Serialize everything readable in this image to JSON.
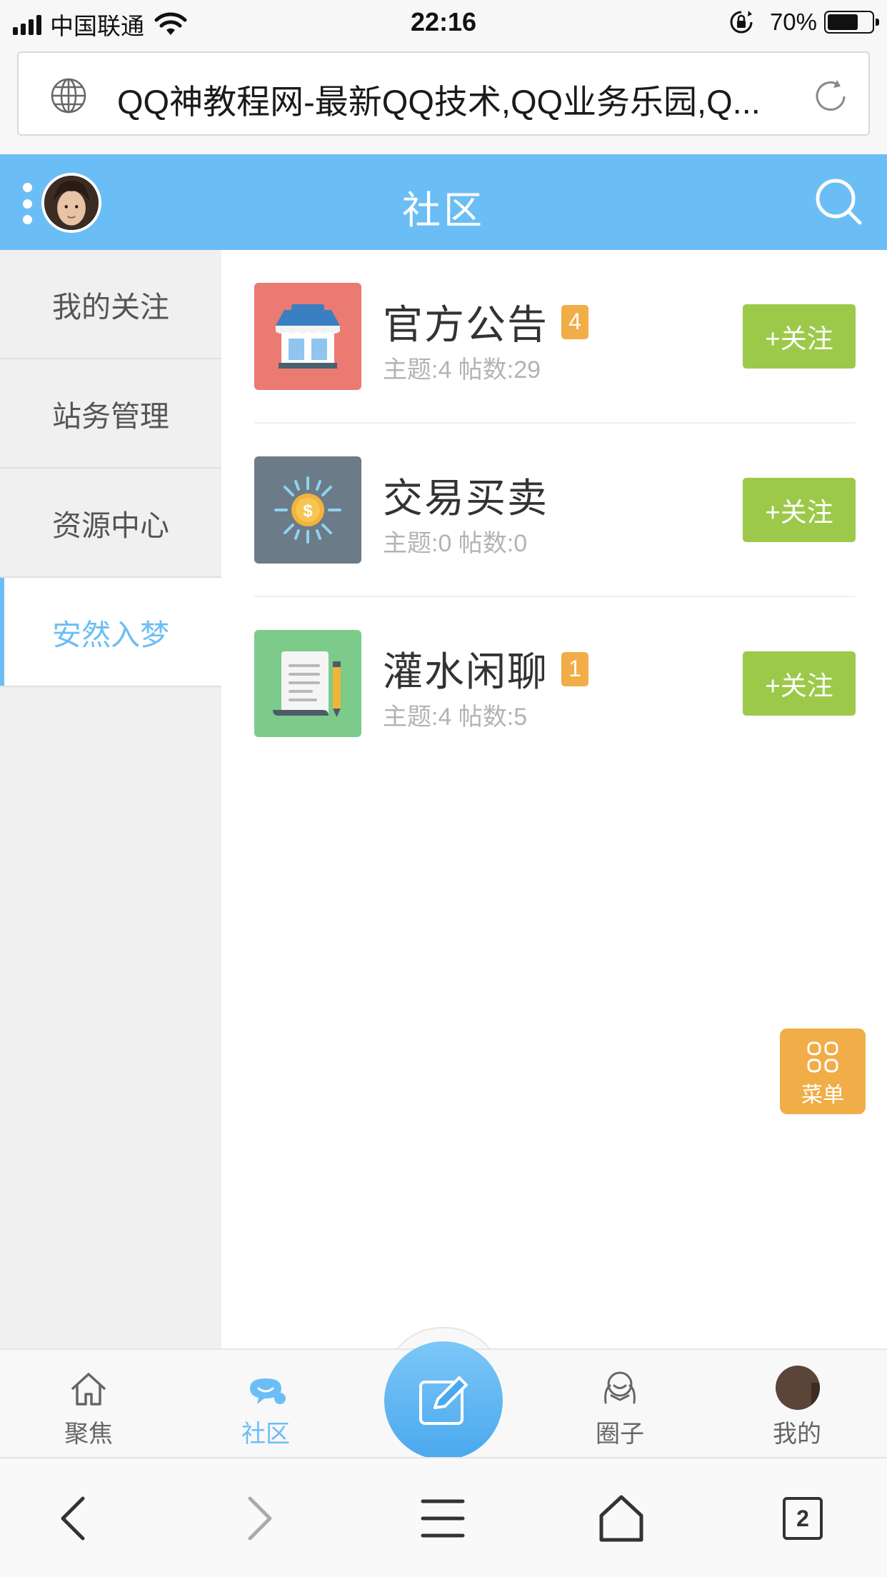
{
  "status_bar": {
    "carrier": "中国联通",
    "time": "22:16",
    "battery_percent": "70%",
    "battery_level": 0.7
  },
  "address_bar": {
    "url_title": "QQ神教程网-最新QQ技术,QQ业务乐园,Q..."
  },
  "header": {
    "title": "社区"
  },
  "sidebar": {
    "items": [
      {
        "label": "我的关注"
      },
      {
        "label": "站务管理"
      },
      {
        "label": "资源中心"
      },
      {
        "label": "安然入梦",
        "active": true
      }
    ]
  },
  "forums": [
    {
      "name": "官方公告",
      "badge": "4",
      "stats": "主题:4 帖数:29",
      "follow_label": "+关注",
      "icon": "store-icon",
      "icon_bg": "#ea7a72"
    },
    {
      "name": "交易买卖",
      "badge": "",
      "stats": "主题:0 帖数:0",
      "follow_label": "+关注",
      "icon": "coin-sun-icon",
      "icon_bg": "#6c7b88"
    },
    {
      "name": "灌水闲聊",
      "badge": "1",
      "stats": "主题:4 帖数:5",
      "follow_label": "+关注",
      "icon": "scroll-pen-icon",
      "icon_bg": "#7ccb8b"
    }
  ],
  "float_menu": {
    "label": "菜单"
  },
  "tabbar": {
    "tabs": [
      {
        "label": "聚焦",
        "icon": "home-icon"
      },
      {
        "label": "社区",
        "icon": "chat-icon",
        "active": true
      },
      {
        "label": "圈子",
        "icon": "people-icon"
      },
      {
        "label": "我的",
        "icon": "avatar"
      }
    ],
    "compose_icon": "compose-icon"
  },
  "browser_bar": {
    "tabs_count": "2"
  },
  "colors": {
    "primary": "#6bbef5",
    "follow_button": "#9cc94a",
    "badge": "#f1ad47",
    "sidebar_bg": "#f0f0f0"
  }
}
